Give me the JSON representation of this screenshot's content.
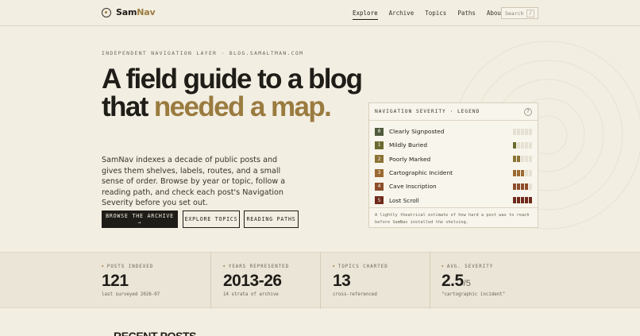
{
  "brand": {
    "name_main": "Sam",
    "name_accent": "Nav"
  },
  "nav": {
    "items": [
      {
        "label": "Explore",
        "active": true
      },
      {
        "label": "Archive"
      },
      {
        "label": "Topics"
      },
      {
        "label": "Paths"
      },
      {
        "label": "About"
      }
    ],
    "search": {
      "label": "Search",
      "shortcut": "/"
    }
  },
  "hero": {
    "eyebrow": "INDEPENDENT NAVIGATION LAYER · BLOG.SAMALTMAN.COM",
    "headline_plain": "A field guide to a blog that ",
    "headline_accent": "needed a map.",
    "intro": "SamNav indexes a decade of public posts and gives them shelves, labels, routes, and a small sense of order. Browse by year or topic, follow a reading path, and check each post's Navigation Severity before you set out.",
    "buttons": {
      "primary": "BROWSE THE ARCHIVE →",
      "topics": "EXPLORE TOPICS",
      "paths": "READING PATHS"
    }
  },
  "legend": {
    "title": "NAVIGATION SEVERITY · LEGEND",
    "help": "?",
    "rows": [
      {
        "level": "0",
        "name": "Clearly Signposted",
        "color": "#4f5a3c",
        "filled": 0
      },
      {
        "level": "1",
        "name": "Mildly Buried",
        "color": "#6a6a2e",
        "filled": 1
      },
      {
        "level": "2",
        "name": "Poorly Marked",
        "color": "#8c7335",
        "filled": 2
      },
      {
        "level": "3",
        "name": "Cartographic Incident",
        "color": "#9c6a32",
        "filled": 3
      },
      {
        "level": "4",
        "name": "Cave Inscription",
        "color": "#8e4d2a",
        "filled": 4
      },
      {
        "level": "5",
        "name": "Lost Scroll",
        "color": "#6f2a1c",
        "filled": 5
      }
    ],
    "footnote": "A lightly theatrical estimate of how hard a post was to reach before SamNav installed the shelving."
  },
  "stats": [
    {
      "label": "POSTS INDEXED",
      "value": "121",
      "suffix": "",
      "sub": "last surveyed 2026-07"
    },
    {
      "label": "YEARS REPRESENTED",
      "value": "2013-26",
      "suffix": "",
      "sub": "14 strata of archive"
    },
    {
      "label": "TOPICS CHARTED",
      "value": "13",
      "suffix": "",
      "sub": "cross-referenced"
    },
    {
      "label": "AVG. SEVERITY",
      "value": "2.5",
      "suffix": "/5",
      "sub": "\"cartographic incident\""
    }
  ],
  "recent": {
    "heading": "RECENT POSTS"
  },
  "colors": {
    "accent": "#9a7b3f",
    "ink": "#1f1d18",
    "paper": "#f3eee2"
  }
}
